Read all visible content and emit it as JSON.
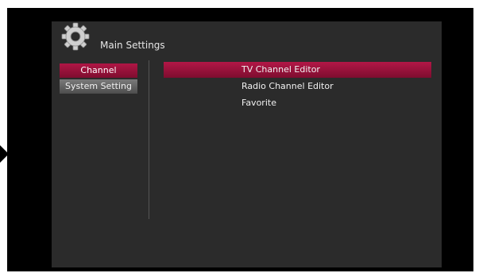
{
  "header": {
    "title": "Main Settings",
    "icon": "gear-icon"
  },
  "left_menu": {
    "items": [
      {
        "label": "Channel",
        "state": "active"
      },
      {
        "label": "System Setting",
        "state": "normal"
      }
    ]
  },
  "right_menu": {
    "items": [
      {
        "label": "TV Channel Editor",
        "selected": true
      },
      {
        "label": "Radio Channel Editor",
        "selected": false
      },
      {
        "label": "Favorite",
        "selected": false
      }
    ]
  },
  "colors": {
    "accent": "#9a1238",
    "panel": "#2b2b2b",
    "background": "#000000"
  }
}
